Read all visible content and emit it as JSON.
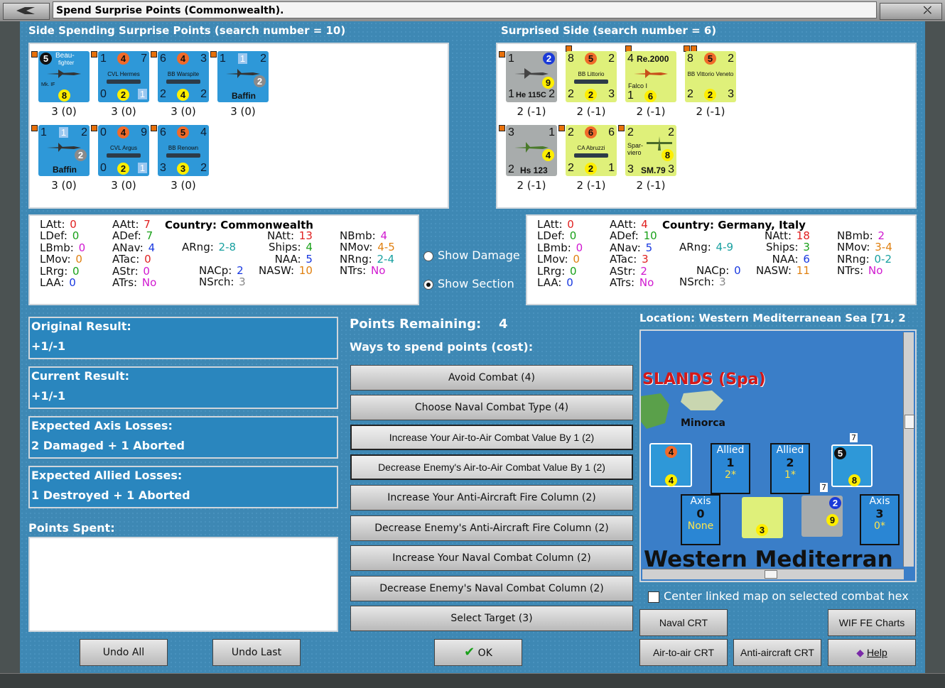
{
  "window": {
    "title": "Spend Surprise Points (Commonwealth)."
  },
  "spending": {
    "header": "Side Spending Surprise Points (search number = 10)",
    "units": [
      {
        "top": "Beau-",
        "top2": "fighter",
        "name": "Mk. IF",
        "tl": "5",
        "br": "8",
        "label": "3 (0)"
      },
      {
        "tl": "1",
        "tm": "4",
        "tr": "7",
        "name": "CVL Hermes",
        "bl": "0",
        "bm": "2",
        "br": "1",
        "label": "3 (0)"
      },
      {
        "tl": "6",
        "tm": "4",
        "tr": "3",
        "name": "BB Warspite",
        "bl": "2",
        "bm": "4",
        "br": "2",
        "label": "3 (0)"
      },
      {
        "tl": "1",
        "tm": "1",
        "tr": "2",
        "name": "Baffin",
        "mid": "2",
        "label": "3 (0)"
      },
      {
        "tl": "1",
        "tm": "1",
        "tr": "2",
        "name": "Baffin",
        "mid": "2",
        "label": "3 (0)"
      },
      {
        "tl": "0",
        "tm": "4",
        "tr": "9",
        "name": "CVL Argus",
        "bl": "0",
        "bm": "2",
        "br": "1",
        "label": "3 (0)"
      },
      {
        "tl": "6",
        "tm": "5",
        "tr": "4",
        "name": "BB Renown",
        "bl": "3",
        "bm": "3",
        "br": "2",
        "label": "3 (0)"
      }
    ]
  },
  "surprised": {
    "header": "Surprised Side (search number = 6)",
    "units": [
      {
        "tl": "1",
        "tr": "2",
        "mid": "9",
        "name": "He 115C",
        "bl": "1",
        "br": "2",
        "label": "2 (-1)"
      },
      {
        "tl": "8",
        "tm": "5",
        "tr": "2",
        "name": "BB Littorio",
        "bl": "2",
        "bm": "2",
        "br": "3",
        "label": "2 (-1)"
      },
      {
        "tl": "4",
        "tm": "Re.2000",
        "name": "Falco I",
        "bl": "1",
        "bm": "6",
        "label": "2 (-1)"
      },
      {
        "tl": "8",
        "tm": "5",
        "tr": "2",
        "name": "BB Vittorio Veneto",
        "bl": "2",
        "bm": "2",
        "br": "3",
        "label": "2 (-1)"
      },
      {
        "tl": "3",
        "tr": "1",
        "mid": "4",
        "name": "Hs 123",
        "bl": "2",
        "label": "2 (-1)"
      },
      {
        "tl": "2",
        "tm": "6",
        "tr": "6",
        "name": "CA Abruzzi",
        "bl": "2",
        "bm": "2",
        "br": "1",
        "label": "2 (-1)"
      },
      {
        "tl": "2",
        "tr": "2",
        "name": "SM.79",
        "extra": "Spar- viero",
        "mid": "8",
        "bl": "3",
        "br": "3",
        "label": "2 (-1)"
      }
    ]
  },
  "left_stats": {
    "country": "Country: Commonwealth",
    "rows": [
      [
        "LAtt:",
        "0",
        "AAtt:",
        "7"
      ],
      [
        "LDef:",
        "0",
        "ADef:",
        "7"
      ],
      [
        "LBmb:",
        "0",
        "ANav:",
        "4"
      ],
      [
        "LMov:",
        "0",
        "ATac:",
        "0"
      ],
      [
        "LRrg:",
        "0",
        "AStr:",
        "0"
      ],
      [
        "LAA:",
        "0",
        "ATrs:",
        "No"
      ]
    ],
    "col3": [
      [
        "ARng:",
        "2-8"
      ],
      [
        "NACp:",
        "2"
      ],
      [
        "NSrch:",
        "3"
      ]
    ],
    "col4": [
      [
        "NAtt:",
        "13"
      ],
      [
        "Ships:",
        "4"
      ],
      [
        "NAA:",
        "5"
      ],
      [
        "NASW:",
        "10"
      ]
    ],
    "col5": [
      [
        "NBmb:",
        "4"
      ],
      [
        "NMov:",
        "4-5"
      ],
      [
        "NRng:",
        "2-4"
      ],
      [
        "NTrs:",
        "No"
      ]
    ]
  },
  "right_stats": {
    "country": "Country: Germany, Italy",
    "rows": [
      [
        "LAtt:",
        "0",
        "AAtt:",
        "4"
      ],
      [
        "LDef:",
        "0",
        "ADef:",
        "10"
      ],
      [
        "LBmb:",
        "0",
        "ANav:",
        "5"
      ],
      [
        "LMov:",
        "0",
        "ATac:",
        "3"
      ],
      [
        "LRrg:",
        "0",
        "AStr:",
        "2"
      ],
      [
        "LAA:",
        "0",
        "ATrs:",
        "No"
      ]
    ],
    "col3": [
      [
        "ARng:",
        "4-9"
      ],
      [
        "NACp:",
        "0"
      ],
      [
        "NSrch:",
        "3"
      ]
    ],
    "col4": [
      [
        "NAtt:",
        "18"
      ],
      [
        "Ships:",
        "3"
      ],
      [
        "NAA:",
        "6"
      ],
      [
        "NASW:",
        "11"
      ]
    ],
    "col5": [
      [
        "NBmb:",
        "2"
      ],
      [
        "NMov:",
        "3-4"
      ],
      [
        "NRng:",
        "0-2"
      ],
      [
        "NTrs:",
        "No"
      ]
    ]
  },
  "view_options": {
    "show_damage": "Show Damage",
    "show_section": "Show Section"
  },
  "results": {
    "original_label": "Original Result:",
    "original_value": "+1/-1",
    "current_label": "Current Result:",
    "current_value": "+1/-1",
    "axis_label": "Expected Axis Losses:",
    "axis_value": "2 Damaged + 1 Aborted",
    "allied_label": "Expected Allied Losses:",
    "allied_value": "1 Destroyed + 1 Aborted",
    "points_spent_label": "Points Spent:"
  },
  "spend": {
    "remaining_label": "Points Remaining:",
    "remaining_value": "4",
    "ways_label": "Ways to spend points (cost):",
    "options": [
      "Avoid Combat (4)",
      "Choose Naval Combat Type (4)",
      "Increase Your Air-to-Air Combat Value By 1 (2)",
      "Decrease Enemy's Air-to-Air Combat Value By 1 (2)",
      "Increase Your Anti-Aircraft Fire Column (2)",
      "Decrease Enemy's Anti-Aircraft Fire Column (2)",
      "Increase Your Naval Combat Column (2)",
      "Decrease Enemy's Naval Combat Column (2)",
      "Select Target (3)"
    ]
  },
  "buttons": {
    "undo_all": "Undo All",
    "undo_last": "Undo Last",
    "ok": "OK",
    "naval_crt": "Naval CRT",
    "wif_fe_charts": "WIF FE Charts",
    "air_to_air_crt": "Air-to-air CRT",
    "anti_aircraft_crt": "Anti-aircraft CRT",
    "help": "Help"
  },
  "map": {
    "location": "Location: Western Mediterranean Sea [71, 2",
    "islands": "SLANDS (Spa)",
    "minorca": "Minorca",
    "sea_name": "Western Mediterran",
    "allied1": {
      "side": "Allied",
      "n": "1",
      "v": "2*"
    },
    "allied2": {
      "side": "Allied",
      "n": "2",
      "v": "1*"
    },
    "axis0": {
      "side": "Axis",
      "n": "0",
      "v": "None"
    },
    "axis3": {
      "side": "Axis",
      "n": "3",
      "v": "0*"
    },
    "stack7a": "7",
    "stack7b": "7",
    "center_linked": "Center linked map on selected combat hex"
  }
}
